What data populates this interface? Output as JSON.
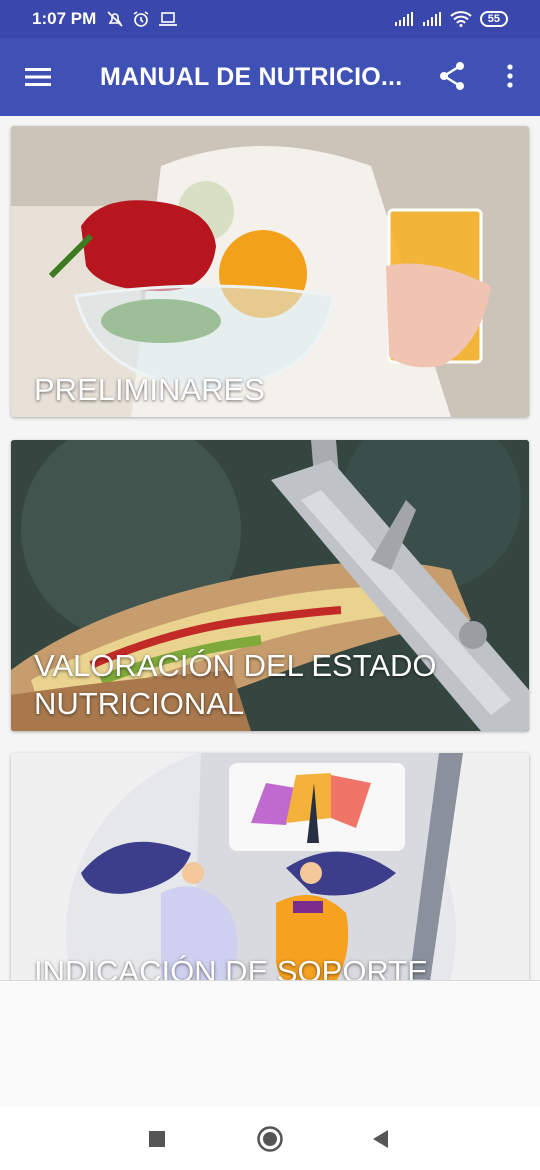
{
  "status_bar": {
    "time": "1:07 PM",
    "battery": "55",
    "icons_left": [
      "mute-icon",
      "alarm-icon",
      "laptop-icon"
    ],
    "icons_right": [
      "signal-icon",
      "signal-icon",
      "wifi-icon",
      "battery-icon"
    ]
  },
  "app_bar": {
    "title": "MANUAL DE NUTRICIO...",
    "icons": [
      "menu-icon",
      "share-icon",
      "more-vert-icon"
    ],
    "color": "#3f51b5"
  },
  "cards": [
    {
      "title": "PRELIMINARES",
      "image": "vegetables-and-juice-photo"
    },
    {
      "title": "VALORACIÓN DEL ESTADO NUTRICIONAL",
      "image": "sandwich-caliper-photo"
    },
    {
      "title": "INDICACIÓN DE SOPORTE",
      "image": "scale-illustration"
    }
  ],
  "nav_bar": {
    "buttons": [
      "recents-icon",
      "home-icon",
      "back-icon"
    ]
  }
}
